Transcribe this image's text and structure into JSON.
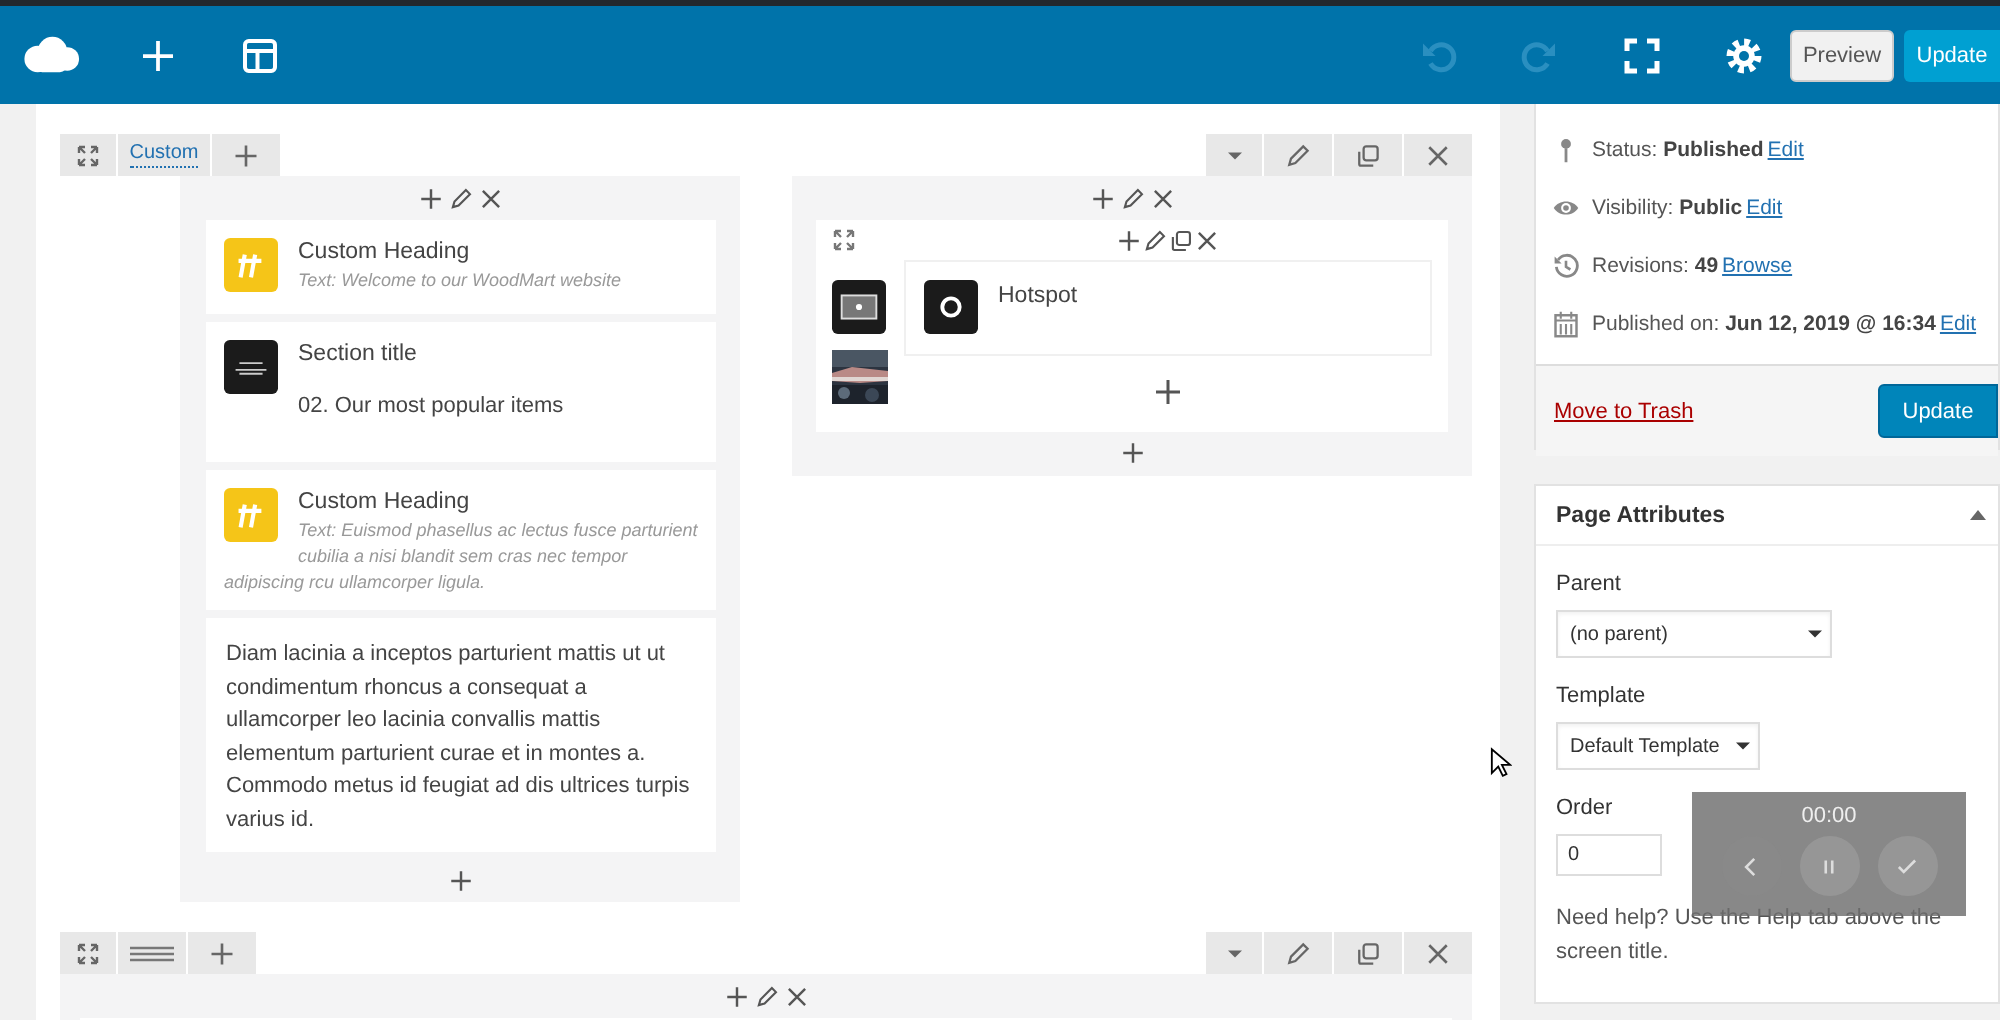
{
  "toolbar": {
    "preview_label": "Preview",
    "update_label": "Update"
  },
  "rows": [
    {
      "layout": {
        "kind": "label",
        "text": "Custom"
      },
      "columns": [
        {
          "elements": [
            {
              "kind": "heading",
              "title": "Custom Heading",
              "text": "Text: Welcome to our WoodMart website"
            },
            {
              "kind": "section_title",
              "title": "Section title",
              "text": "02. Our most popular items"
            },
            {
              "kind": "heading",
              "title": "Custom Heading",
              "text": "Text: Euismod phasellus ac lectus fusce parturient cubilia a nisi blandit sem cras nec tempor adipiscing rcu ullamcorper ligula."
            },
            {
              "kind": "text",
              "text": "Diam lacinia a inceptos parturient mattis ut ut condimentum rhoncus a consequat a ullamcorper leo lacinia convallis mattis elementum parturient curae et in montes a. Commodo metus id feugiat ad dis ultrices turpis varius id."
            }
          ]
        },
        {
          "inner_row": {
            "elements": [
              {
                "kind": "hotspot",
                "title": "Hotspot"
              }
            ]
          }
        }
      ]
    },
    {
      "layout": {
        "kind": "lines"
      },
      "columns": [
        {
          "kind": "stub"
        }
      ]
    }
  ],
  "sidebar": {
    "publish": {
      "meta": [
        {
          "kind": "status",
          "label": "Status:",
          "value": "Published",
          "link": "Edit"
        },
        {
          "kind": "visibility",
          "label": "Visibility:",
          "value": "Public",
          "link": "Edit"
        },
        {
          "kind": "revisions",
          "label": "Revisions:",
          "value": "49",
          "link": "Browse"
        },
        {
          "kind": "published",
          "label": "Published on:",
          "value": "Jun 12, 2019 @ 16:34",
          "link": "Edit"
        }
      ],
      "trash_link": "Move to Trash",
      "update_label": "Update"
    },
    "page_attributes": {
      "title": "Page Attributes",
      "expanded": true,
      "fields": [
        {
          "kind": "select",
          "label": "Parent",
          "value": "(no parent)"
        },
        {
          "kind": "select",
          "label": "Template",
          "value": "Default Template"
        },
        {
          "kind": "input",
          "label": "Order",
          "value": "0"
        }
      ],
      "help": "Need help? Use the Help tab above the screen title."
    }
  },
  "recorder": {
    "time": "00:00"
  }
}
